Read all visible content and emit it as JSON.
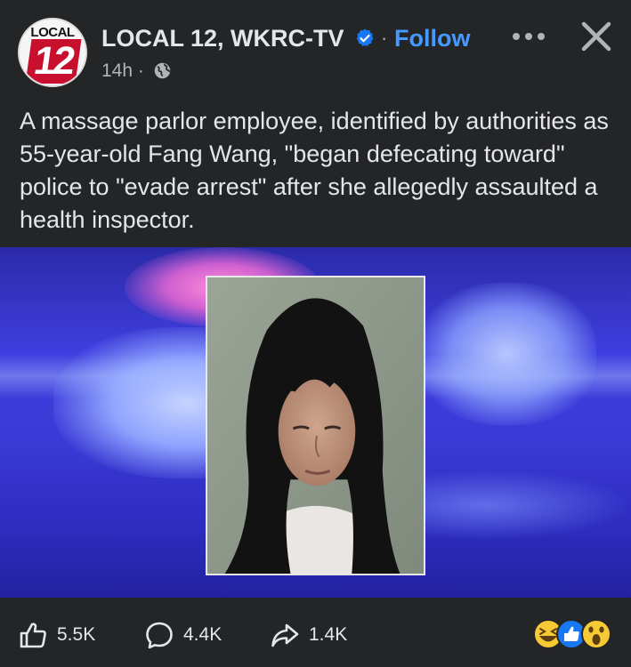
{
  "post": {
    "page_name": "LOCAL 12, WKRC-TV",
    "follow_label": "Follow",
    "separator": "·",
    "time": "14h ·",
    "avatar": {
      "logo_text": "LOCAL",
      "logo_number": "12"
    },
    "body": "A massage parlor employee, identified by authorities as 55-year-old Fang Wang, \"began defecating toward\" police to \"evade arrest\" after she allegedly assaulted a health inspector."
  },
  "footer": {
    "likes": "5.5K",
    "comments": "4.4K",
    "shares": "1.4K"
  },
  "icons": {
    "verified": "verified-badge-icon",
    "more": "more-options-icon",
    "close": "close-icon",
    "audience": "globe-icon",
    "like": "thumbs-up-icon",
    "comment": "comment-bubble-icon",
    "share": "share-arrow-icon",
    "reactions": [
      "haha-reaction-icon",
      "like-reaction-icon",
      "wow-reaction-icon"
    ]
  },
  "colors": {
    "background": "#242526",
    "text": "#e4e6eb",
    "secondary_text": "#b0b3b8",
    "link_blue": "#4599ff",
    "verified_blue": "#1877f2",
    "media_blue": "#3a3ad6"
  }
}
